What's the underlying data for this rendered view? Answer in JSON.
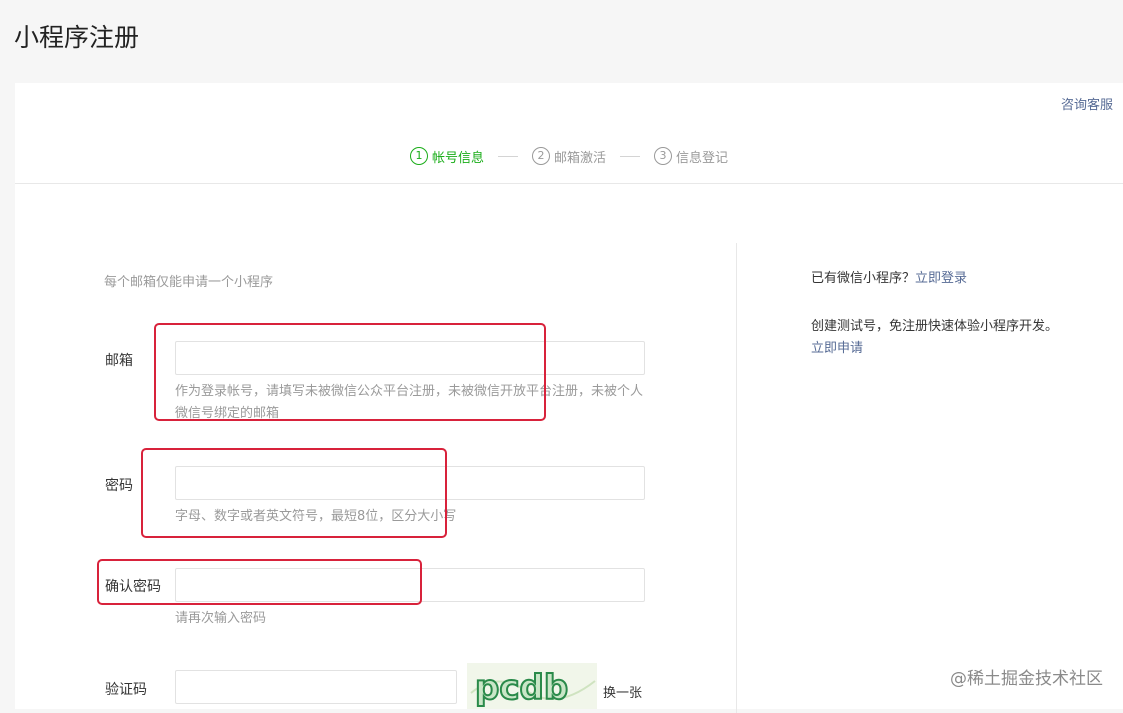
{
  "page": {
    "title": "小程序注册"
  },
  "header": {
    "consult_label": "咨询客服"
  },
  "steps": [
    {
      "num": "1",
      "label": "帐号信息",
      "active": true
    },
    {
      "num": "2",
      "label": "邮箱激活",
      "active": false
    },
    {
      "num": "3",
      "label": "信息登记",
      "active": false
    }
  ],
  "form": {
    "notice": "每个邮箱仅能申请一个小程序",
    "email": {
      "label": "邮箱",
      "value": "",
      "hint": "作为登录帐号，请填写未被微信公众平台注册，未被微信开放平台注册，未被个人微信号绑定的邮箱"
    },
    "password": {
      "label": "密码",
      "value": "",
      "hint": "字母、数字或者英文符号，最短8位，区分大小写"
    },
    "confirm": {
      "label": "确认密码",
      "value": "",
      "hint": "请再次输入密码"
    },
    "captcha": {
      "label": "验证码",
      "value": "",
      "image_text": "pcdb",
      "change_label": "换一张"
    }
  },
  "side": {
    "has_account_text": "已有微信小程序？",
    "login_link": "立即登录",
    "test_text": "创建测试号，免注册快速体验小程序开发。",
    "apply_link": "立即申请"
  },
  "watermark": "@稀土掘金技术社区",
  "colors": {
    "accent": "#1aad19",
    "link": "#576b95",
    "annotation": "#d8223b"
  }
}
